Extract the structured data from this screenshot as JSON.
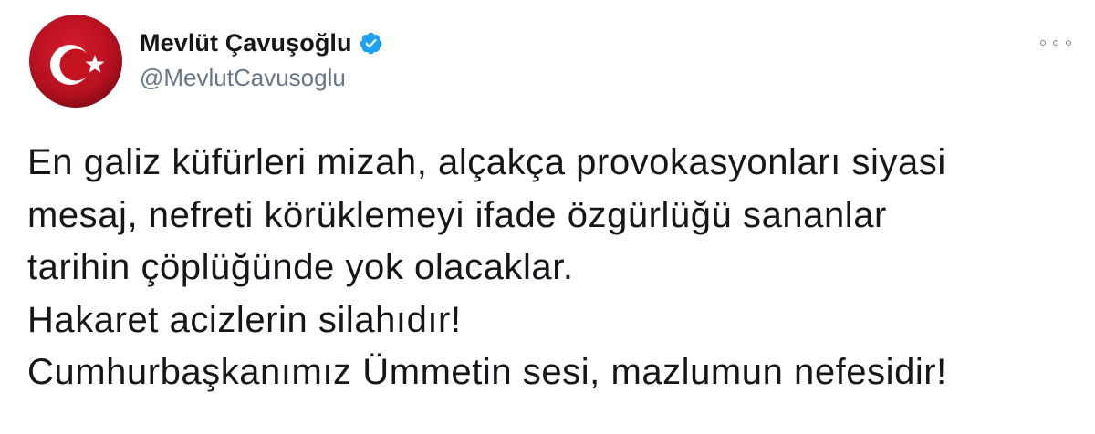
{
  "author": {
    "display_name": "Mevlüt Çavuşoğlu",
    "handle": "@MevlutCavusoglu",
    "verified": true,
    "avatar": "turkish-flag-avatar"
  },
  "menu": {
    "icon": "more-options-icon"
  },
  "tweet": {
    "lines": [
      "En galiz küfürleri mizah, alçakça provokasyonları siyasi",
      "mesaj, nefreti körüklemeyi ifade özgürlüğü sananlar",
      "tarihin çöplüğünde yok olacaklar.",
      "Hakaret acizlerin silahıdır!",
      "Cumhurbaşkanımız Ümmetin sesi, mazlumun nefesidir!"
    ]
  },
  "colors": {
    "text": "#14171a",
    "secondary": "#657786",
    "verified_blue": "#1da1f2",
    "flag_red": "#c8102e"
  }
}
